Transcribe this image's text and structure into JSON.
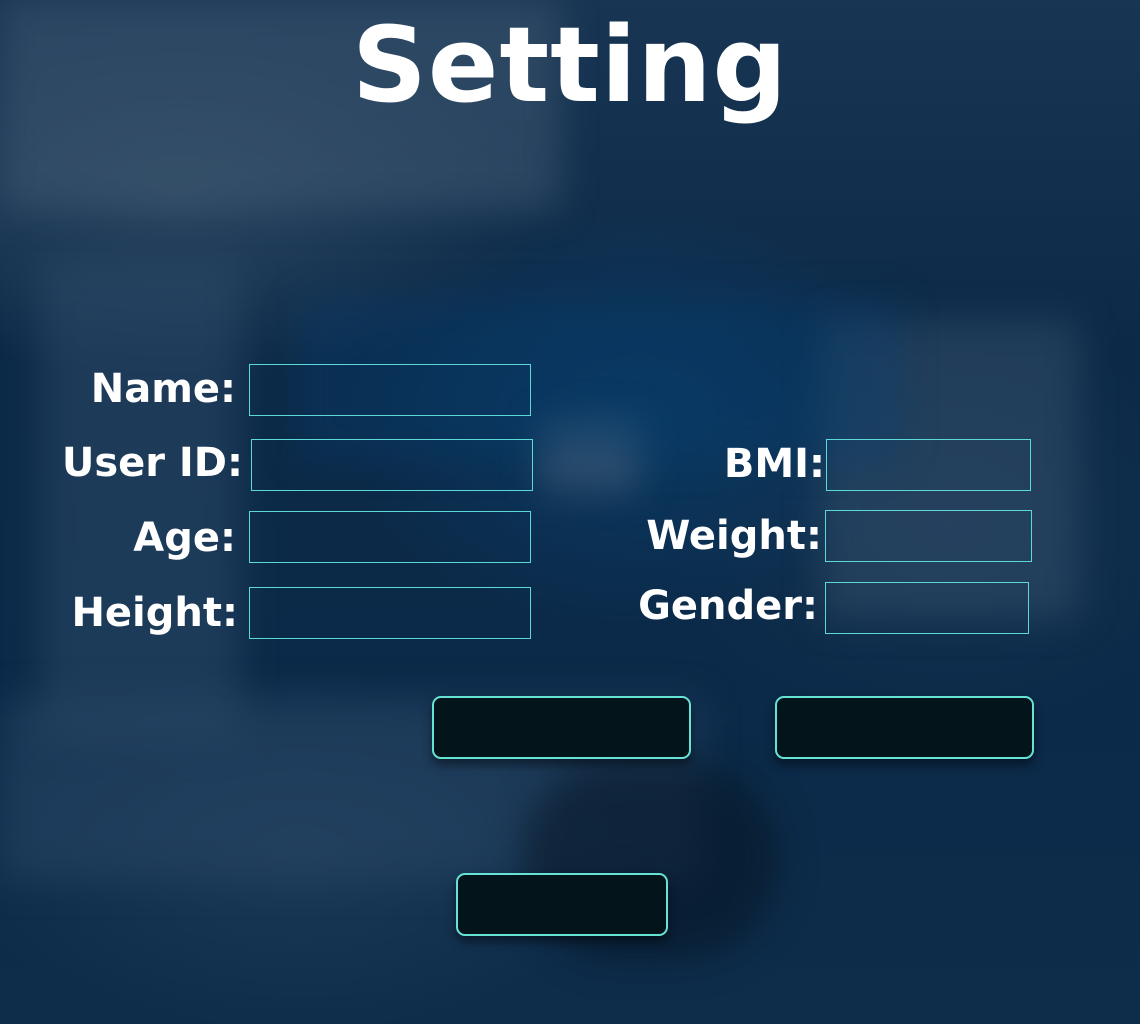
{
  "page": {
    "title": "Setting"
  },
  "form": {
    "name": {
      "label": "Name:",
      "value": ""
    },
    "user_id": {
      "label": "User ID:",
      "value": ""
    },
    "age": {
      "label": "Age:",
      "value": ""
    },
    "height": {
      "label": "Height:",
      "value": ""
    },
    "bmi": {
      "label": "BMI:",
      "value": ""
    },
    "weight": {
      "label": "Weight:",
      "value": ""
    },
    "gender": {
      "label": "Gender:",
      "value": ""
    }
  },
  "buttons": {
    "left_label": "",
    "right_label": "",
    "bottom_label": ""
  },
  "colors": {
    "accent": "#5ad9d6",
    "button_fill": "#03141a",
    "background": "#0c2a48"
  }
}
